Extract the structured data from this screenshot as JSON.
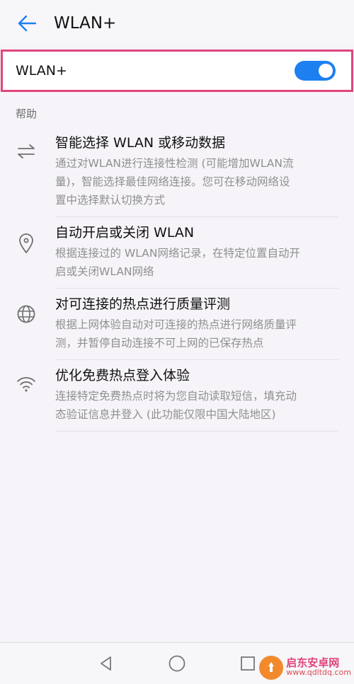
{
  "header": {
    "title": "WLAN+"
  },
  "toggle": {
    "label": "WLAN+",
    "enabled": true,
    "accent_color": "#1d7ff0"
  },
  "highlight": {
    "color": "#e0457b"
  },
  "section": {
    "title": "帮助"
  },
  "help_items": [
    {
      "icon": "arrows-swap-icon",
      "title": "智能选择 WLAN 或移动数据",
      "desc_lines": [
        "通过对WLAN进行连接性检测 (可能增加WLAN流",
        "量)，智能选择最佳网络连接。您可在移动网络设",
        "置中选择默认切换方式"
      ]
    },
    {
      "icon": "location-pin-icon",
      "title": "自动开启或关闭 WLAN",
      "desc_lines": [
        "根据连接过的 WLAN网络记录，在特定位置自动开",
        "启或关闭WLAN网络"
      ]
    },
    {
      "icon": "globe-icon",
      "title": "对可连接的热点进行质量评测",
      "desc_lines": [
        "根据上网体验自动对可连接的热点进行网络质量评",
        "测，并暂停自动连接不可上网的已保存热点"
      ]
    },
    {
      "icon": "wifi-icon",
      "title": "优化免费热点登入体验",
      "desc_lines": [
        "连接特定免费热点时将为您自动读取短信，填充动",
        "态验证信息并登入 (此功能仅限中国大陆地区)"
      ]
    }
  ],
  "watermark": {
    "name": "启东安卓网",
    "url": "www.qdltdq.com"
  }
}
